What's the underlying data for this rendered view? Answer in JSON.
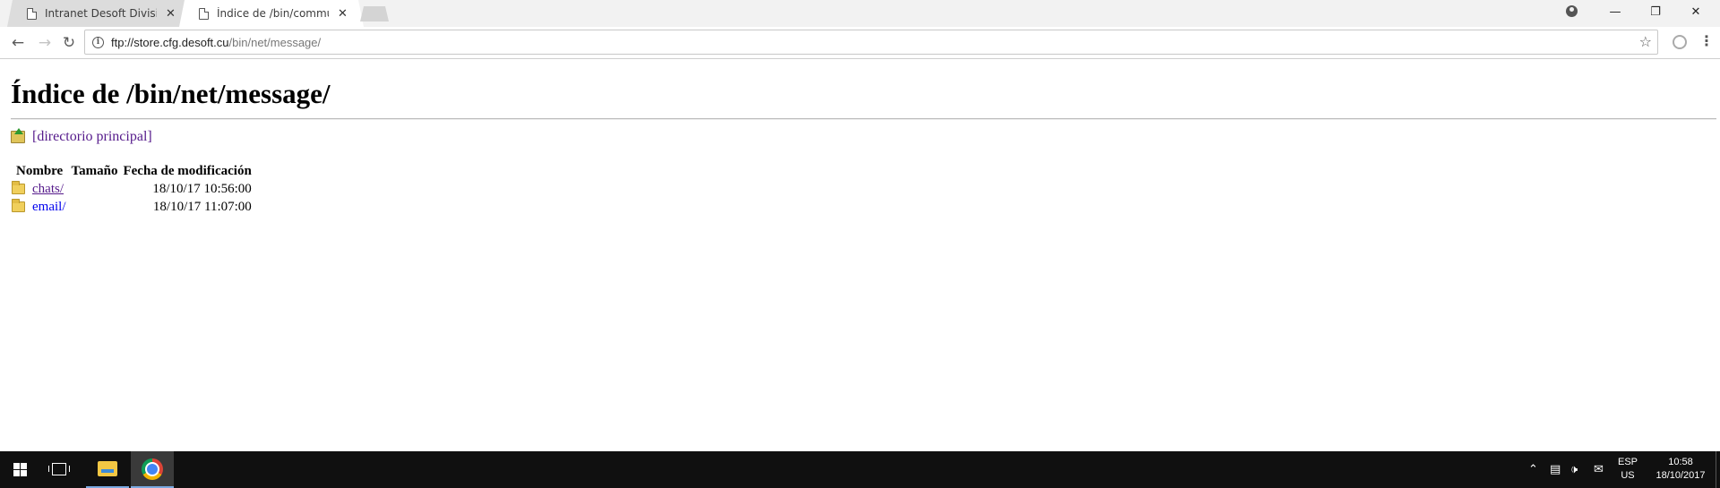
{
  "browser": {
    "tabs": [
      {
        "title": "Intranet Desoft Division F",
        "active": false
      },
      {
        "title": "Índice de /bin/communica",
        "active": true
      }
    ],
    "tab_close_glyph": "✕",
    "window_controls": {
      "minimize": "—",
      "restore": "❐",
      "close": "✕"
    },
    "address": {
      "host": "ftp://store.cfg.desoft.cu",
      "path": "/bin/net/message/"
    },
    "icons": [
      "back-arrow-icon",
      "forward-arrow-icon",
      "reload-icon",
      "info-icon",
      "star-icon",
      "extension-icon",
      "menu-icon",
      "account-icon"
    ]
  },
  "page": {
    "heading": "Índice de /bin/net/message/",
    "parent_link": "[directorio principal]",
    "columns": {
      "name": "Nombre",
      "size": "Tamaño",
      "date": "Fecha de modificación"
    },
    "entries": [
      {
        "name": "chats/",
        "size": "",
        "date": "18/10/17 10:56:00",
        "visited": true
      },
      {
        "name": "email/",
        "size": "",
        "date": "18/10/17 11:07:00",
        "visited": false
      }
    ]
  },
  "taskbar": {
    "apps": [
      "file-explorer-icon",
      "chrome-icon"
    ],
    "language": {
      "line1": "ESP",
      "line2": "US"
    },
    "clock": {
      "time": "10:58",
      "date": "18/10/2017"
    }
  }
}
